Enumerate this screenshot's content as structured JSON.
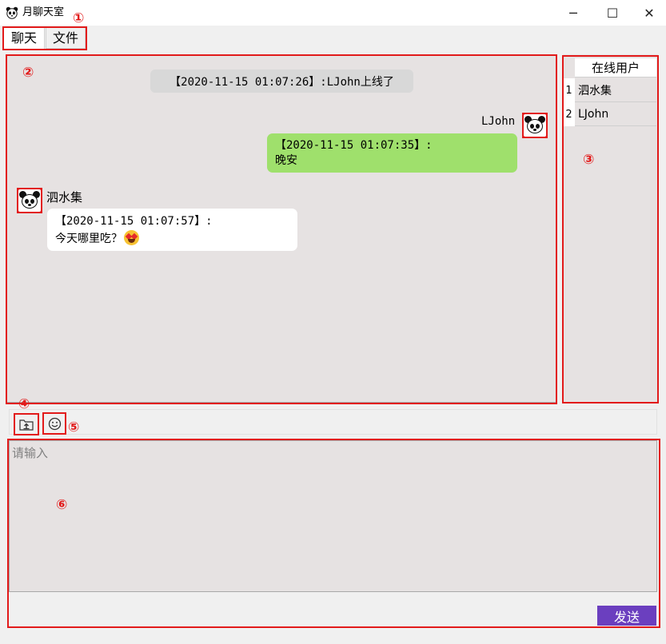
{
  "window": {
    "title": "月聊天室",
    "app_icon": "panda-icon",
    "controls": {
      "minimize": "─",
      "maximize": "☐",
      "close": "✕"
    }
  },
  "tabs": [
    {
      "label": "聊天",
      "selected": true
    },
    {
      "label": "文件",
      "selected": false
    }
  ],
  "chat": {
    "system_message": "【2020-11-15 01:07:26】:LJohn上线了",
    "messages": [
      {
        "sender": "LJohn",
        "side": "right",
        "time_line": "【2020-11-15 01:07:35】:",
        "text": "晚安",
        "bubble_color": "#9fe06c"
      },
      {
        "sender": "泗水集",
        "side": "left",
        "time_line": "【2020-11-15 01:07:57】:",
        "text": "今天哪里吃？",
        "emoji": "heart-eyes-emoji-icon",
        "bubble_color": "#ffffff"
      }
    ]
  },
  "online_users": {
    "header": "在线用户",
    "rows": [
      {
        "index": "1",
        "name": "泗水集"
      },
      {
        "index": "2",
        "name": "LJohn"
      }
    ]
  },
  "toolbar": {
    "file_button_icon": "upload-file-icon",
    "emoji_button_icon": "smiley-icon"
  },
  "input": {
    "placeholder": "请输入",
    "value": ""
  },
  "send_button": {
    "label": "发送",
    "color": "#6b3fbf"
  },
  "annotations": [
    "①",
    "②",
    "③",
    "④",
    "⑤",
    "⑥"
  ],
  "colors": {
    "annotation": "#e21a1a",
    "panel_bg": "#e6e2e2",
    "avatar_border": "#e21a1a"
  }
}
